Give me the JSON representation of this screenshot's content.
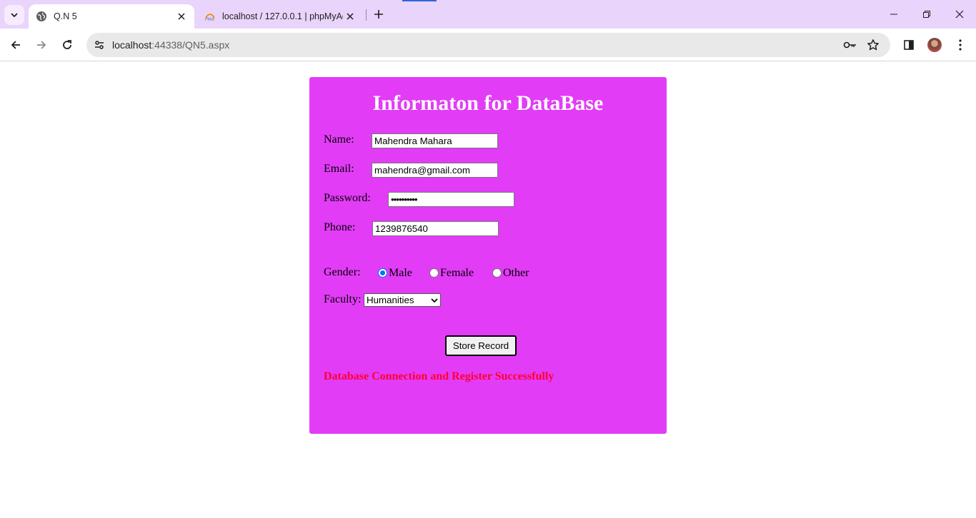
{
  "browser": {
    "tabs": [
      {
        "title": "Q.N 5",
        "active": true,
        "icon": "globe-icon"
      },
      {
        "title": "localhost / 127.0.0.1 | phpMyAd",
        "active": false,
        "icon": "phpmyadmin-icon"
      }
    ],
    "url_host": "localhost",
    "url_path": ":44338/QN5.aspx"
  },
  "form": {
    "heading": "Informaton for DataBase",
    "name_label": "Name:",
    "name_value": "Mahendra Mahara",
    "email_label": "Email:",
    "email_value": "mahendra@gmail.com",
    "password_label": "Password:",
    "password_value": "••••••••••",
    "phone_label": "Phone:",
    "phone_value": "1239876540",
    "gender_label": "Gender:",
    "gender_options": [
      "Male",
      "Female",
      "Other"
    ],
    "gender_selected": "Male",
    "faculty_label": "Faculty:",
    "faculty_selected": "Humanities",
    "submit_label": "Store Record",
    "status_message": "Database Connection and Register Successfully"
  },
  "colors": {
    "panel": "#e23cf7",
    "message": "#ff0033",
    "tabstrip": "#e9d4fb"
  }
}
